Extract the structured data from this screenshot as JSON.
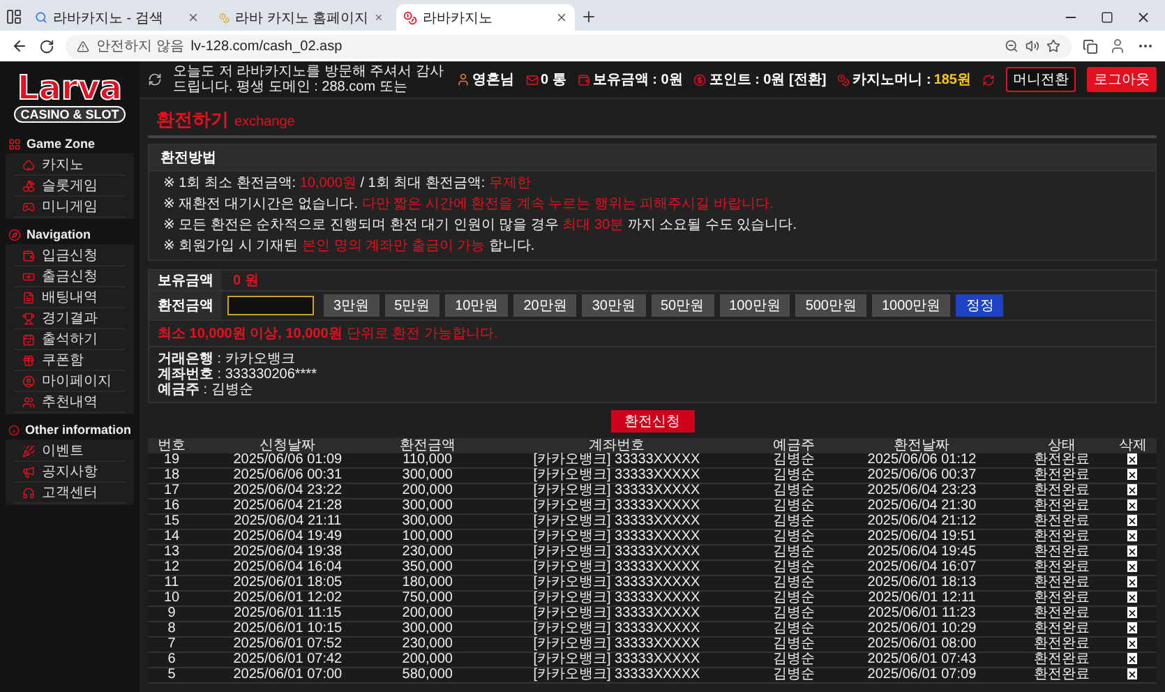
{
  "browser": {
    "tabs": [
      {
        "title": "라바카지노 - 검색",
        "selected": false
      },
      {
        "title": "라바 카지노 홈페이지",
        "selected": false
      },
      {
        "title": "라바카지노",
        "selected": true
      }
    ],
    "security_label": "안전하지 않음",
    "url": "lv-128.com/cash_02.asp"
  },
  "logo": {
    "title": "Larva",
    "subtitle": "CASINO & SLOT"
  },
  "sidebar": {
    "sections": [
      {
        "title": "Game Zone",
        "items": [
          {
            "label": "카지노"
          },
          {
            "label": "슬롯게임"
          },
          {
            "label": "미니게임"
          }
        ]
      },
      {
        "title": "Navigation",
        "items": [
          {
            "label": "입금신청"
          },
          {
            "label": "출금신청"
          },
          {
            "label": "배팅내역"
          },
          {
            "label": "경기결과"
          },
          {
            "label": "출석하기"
          },
          {
            "label": "쿠폰함"
          },
          {
            "label": "마이페이지"
          },
          {
            "label": "추천내역"
          }
        ]
      },
      {
        "title": "Other information",
        "items": [
          {
            "label": "이벤트"
          },
          {
            "label": "공지사항"
          },
          {
            "label": "고객센터"
          }
        ]
      }
    ]
  },
  "header": {
    "marquee": "오늘도 저 라바카지노를 방문해 주셔서 감사드립니다. 평생 도메인 : 288.com 또는",
    "user": "영혼님",
    "messages": "0 통",
    "balance": "보유금액 : 0원",
    "points": "포인트 : 0원",
    "points_convert": "[전환]",
    "casino_money_label": "카지노머니 : ",
    "casino_money_value": "185원",
    "money_convert": "머니전환",
    "logout": "로그아웃"
  },
  "page_title": "환전하기",
  "page_subtitle": "exchange",
  "notice": {
    "title": "환전방법",
    "lines": [
      [
        {
          "text": "※ 1회 최소 환전금액: ",
          "highlight": false
        },
        {
          "text": "10,000원",
          "highlight": true
        },
        {
          "text": " / 1회 최대 환전금액: ",
          "highlight": false
        },
        {
          "text": "무제한",
          "highlight": true
        }
      ],
      [
        {
          "text": "※ 재환전 대기시간은 없습니다. ",
          "highlight": false
        },
        {
          "text": "다만 짧은 시간에 환전을 계속 누르는 행위는 피해주시길 바랍니다.",
          "highlight": true
        }
      ],
      [
        {
          "text": "※ 모든 환전은 순차적으로 진행되며 환전 대기 인원이 많을 경우 ",
          "highlight": false
        },
        {
          "text": "최대 30분",
          "highlight": true
        },
        {
          "text": " 까지 소요될 수도 있습니다.",
          "highlight": false
        }
      ],
      [
        {
          "text": "※ 회원가입 시 기재된 ",
          "highlight": false
        },
        {
          "text": "본인 명의 계좌만 출금이 가능",
          "highlight": true
        },
        {
          "text": " 합니다.",
          "highlight": false
        }
      ]
    ]
  },
  "form": {
    "balance_label": "보유금액",
    "balance_value": "0 원",
    "amount_label": "환전금액",
    "amount_buttons": [
      "3만원",
      "5만원",
      "10만원",
      "20만원",
      "30만원",
      "50만원",
      "100만원",
      "500만원",
      "1000만원"
    ],
    "reset": "정정",
    "hint_main": "최소 10,000원 이상, 10,000원",
    "hint_sub": "단위로 환전 가능합니다.",
    "account": [
      {
        "label": "거래은행",
        "value": " : 카카오뱅크"
      },
      {
        "label": "계좌번호",
        "value": " : 333330206****"
      },
      {
        "label": "예금주",
        "value": " : 김병순"
      }
    ],
    "submit": "환전신청"
  },
  "table": {
    "columns": [
      "번호",
      "신청날짜",
      "환전금액",
      "계좌번호",
      "예금주",
      "환전날짜",
      "상태",
      "삭제"
    ],
    "rows": [
      [
        "19",
        "2025/06/06 01:09",
        "110,000",
        "[카카오뱅크] 33333XXXXX",
        "김병순",
        "2025/06/06 01:12",
        "환전완료"
      ],
      [
        "18",
        "2025/06/06 00:31",
        "300,000",
        "[카카오뱅크] 33333XXXXX",
        "김병순",
        "2025/06/06 00:37",
        "환전완료"
      ],
      [
        "17",
        "2025/06/04 23:22",
        "200,000",
        "[카카오뱅크] 33333XXXXX",
        "김병순",
        "2025/06/04 23:23",
        "환전완료"
      ],
      [
        "16",
        "2025/06/04 21:28",
        "300,000",
        "[카카오뱅크] 33333XXXXX",
        "김병순",
        "2025/06/04 21:30",
        "환전완료"
      ],
      [
        "15",
        "2025/06/04 21:11",
        "300,000",
        "[카카오뱅크] 33333XXXXX",
        "김병순",
        "2025/06/04 21:12",
        "환전완료"
      ],
      [
        "14",
        "2025/06/04 19:49",
        "100,000",
        "[카카오뱅크] 33333XXXXX",
        "김병순",
        "2025/06/04 19:51",
        "환전완료"
      ],
      [
        "13",
        "2025/06/04 19:38",
        "230,000",
        "[카카오뱅크] 33333XXXXX",
        "김병순",
        "2025/06/04 19:45",
        "환전완료"
      ],
      [
        "12",
        "2025/06/04 16:04",
        "350,000",
        "[카카오뱅크] 33333XXXXX",
        "김병순",
        "2025/06/04 16:07",
        "환전완료"
      ],
      [
        "11",
        "2025/06/01 18:05",
        "180,000",
        "[카카오뱅크] 33333XXXXX",
        "김병순",
        "2025/06/01 18:13",
        "환전완료"
      ],
      [
        "10",
        "2025/06/01 12:02",
        "750,000",
        "[카카오뱅크] 33333XXXXX",
        "김병순",
        "2025/06/01 12:11",
        "환전완료"
      ],
      [
        "9",
        "2025/06/01 11:15",
        "200,000",
        "[카카오뱅크] 33333XXXXX",
        "김병순",
        "2025/06/01 11:23",
        "환전완료"
      ],
      [
        "8",
        "2025/06/01 10:15",
        "300,000",
        "[카카오뱅크] 33333XXXXX",
        "김병순",
        "2025/06/01 10:29",
        "환전완료"
      ],
      [
        "7",
        "2025/06/01 07:52",
        "230,000",
        "[카카오뱅크] 33333XXXXX",
        "김병순",
        "2025/06/01 08:00",
        "환전완료"
      ],
      [
        "6",
        "2025/06/01 07:42",
        "200,000",
        "[카카오뱅크] 33333XXXXX",
        "김병순",
        "2025/06/01 07:43",
        "환전완료"
      ],
      [
        "5",
        "2025/06/01 07:00",
        "580,000",
        "[카카오뱅크] 33333XXXXX",
        "김병순",
        "2025/06/01 07:09",
        "환전완료"
      ]
    ]
  }
}
